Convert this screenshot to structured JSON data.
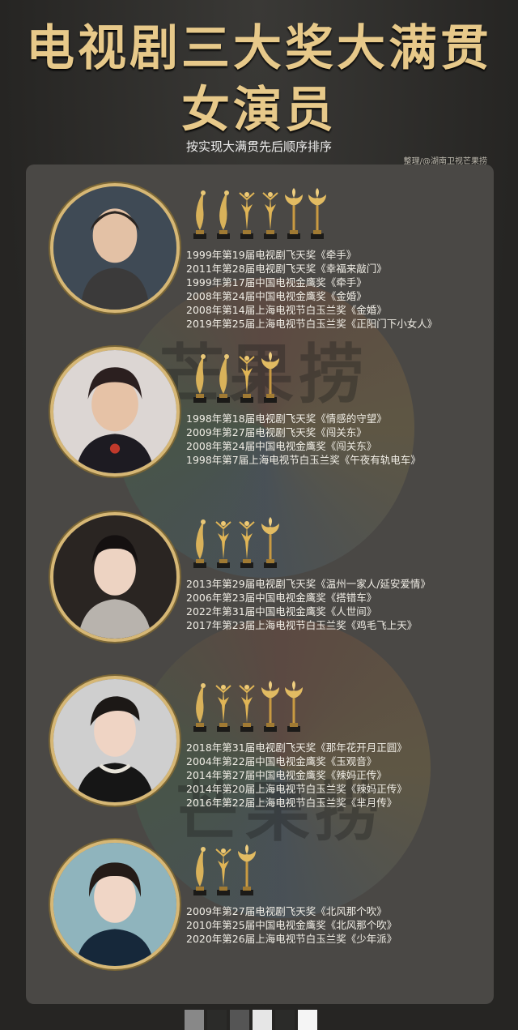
{
  "title_line1": "电视剧三大奖大满贯",
  "title_line2": "女演员",
  "subtitle": "按实现大满贯先后顺序排序",
  "credit": "整理/@湖南卫视芒果捞",
  "watermark": "芒果捞",
  "colors": {
    "gold": "#e7c98a",
    "panel": "#4a4845",
    "background": "#2b2b29"
  },
  "actresses": [
    {
      "trophy_icons": [
        "feitian-trophy-icon",
        "feitian-trophy-icon",
        "jinying-trophy-icon",
        "jinying-trophy-icon",
        "baiyulan-trophy-icon",
        "baiyulan-trophy-icon"
      ],
      "awards": [
        "1999年第19届电视剧飞天奖《牵手》",
        "2011年第28届电视剧飞天奖《幸福来敲门》",
        "1999年第17届中国电视金鹰奖《牵手》",
        "2008年第24届中国电视金鹰奖《金婚》",
        "2008年第14届上海电视节白玉兰奖《金婚》",
        "2019年第25届上海电视节白玉兰奖《正阳门下小女人》"
      ]
    },
    {
      "trophy_icons": [
        "feitian-trophy-icon",
        "feitian-trophy-icon",
        "jinying-trophy-icon",
        "baiyulan-trophy-icon"
      ],
      "awards": [
        "1998年第18届电视剧飞天奖《情感的守望》",
        "2009年第27届电视剧飞天奖《闯关东》",
        "2008年第24届中国电视金鹰奖《闯关东》",
        "1998年第7届上海电视节白玉兰奖《午夜有轨电车》"
      ]
    },
    {
      "trophy_icons": [
        "feitian-trophy-icon",
        "jinying-trophy-icon",
        "jinying-trophy-icon",
        "baiyulan-trophy-icon"
      ],
      "awards": [
        "2013年第29届电视剧飞天奖《温州一家人/延安爱情》",
        "2006年第23届中国电视金鹰奖《搭错车》",
        "2022年第31届中国电视金鹰奖《人世间》",
        "2017年第23届上海电视节白玉兰奖《鸡毛飞上天》"
      ]
    },
    {
      "trophy_icons": [
        "feitian-trophy-icon",
        "jinying-trophy-icon",
        "jinying-trophy-icon",
        "baiyulan-trophy-icon",
        "baiyulan-trophy-icon"
      ],
      "awards": [
        "2018年第31届电视剧飞天奖《那年花开月正圆》",
        "2004年第22届中国电视金鹰奖《玉观音》",
        "2014年第27届中国电视金鹰奖《辣妈正传》",
        "2014年第20届上海电视节白玉兰奖《辣妈正传》",
        "2016年第22届上海电视节白玉兰奖《芈月传》"
      ]
    },
    {
      "trophy_icons": [
        "feitian-trophy-icon",
        "jinying-trophy-icon",
        "baiyulan-trophy-icon"
      ],
      "awards": [
        "2009年第27届电视剧飞天奖《北风那个吹》",
        "2010年第25届中国电视金鹰奖《北风那个吹》",
        "2020年第26届上海电视节白玉兰奖《少年派》"
      ]
    }
  ]
}
